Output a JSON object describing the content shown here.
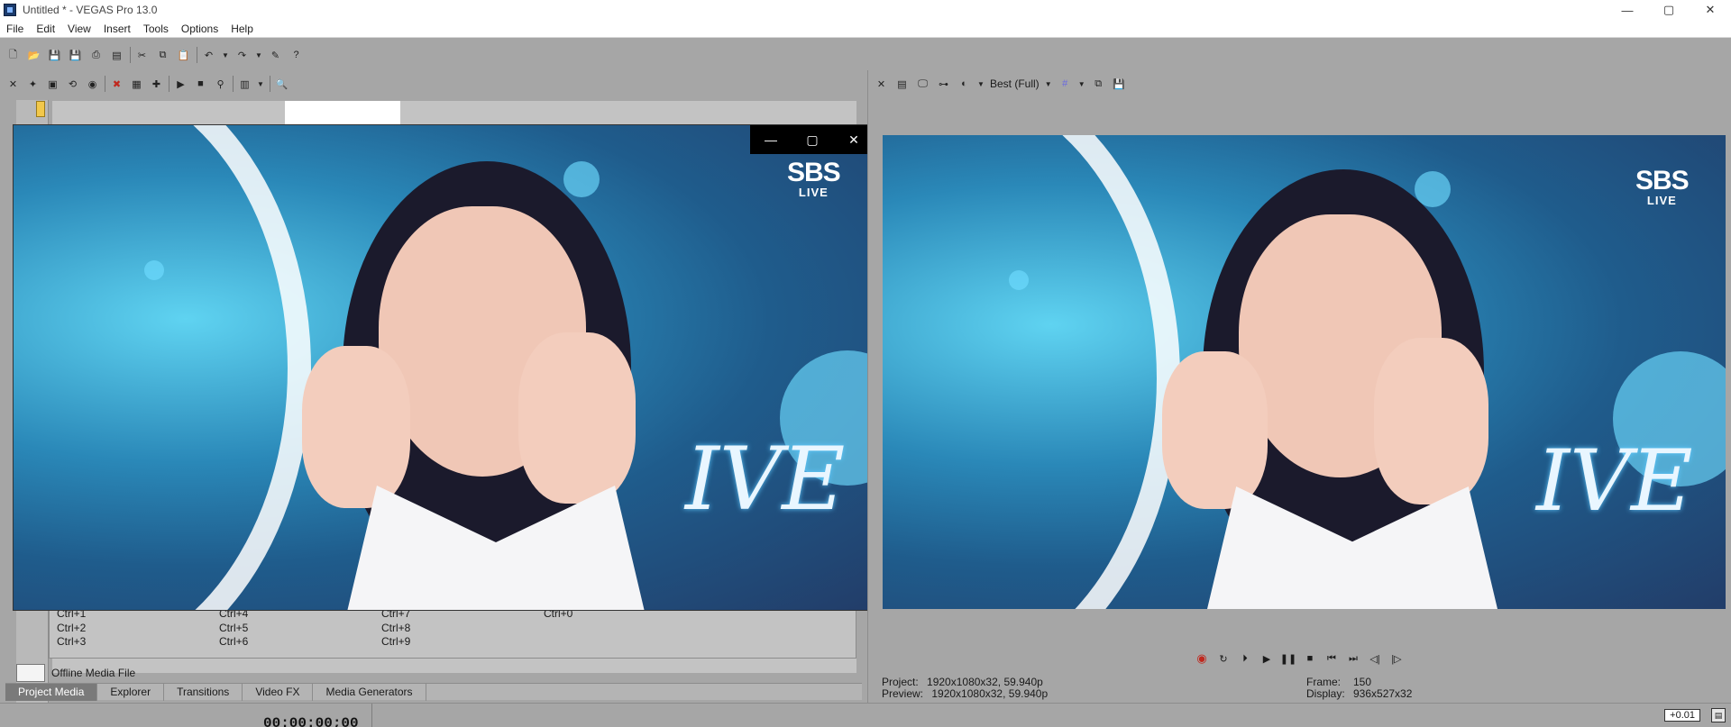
{
  "window": {
    "title": "Untitled * - VEGAS Pro 13.0",
    "minimize": "—",
    "maximize": "▢",
    "close": "✕"
  },
  "menu": [
    "File",
    "Edit",
    "View",
    "Insert",
    "Tools",
    "Options",
    "Help"
  ],
  "main_toolbar_icons": [
    "new-icon",
    "open-icon",
    "save-icon",
    "save-as-icon",
    "render-icon",
    "properties-icon",
    "cut-icon",
    "copy-icon",
    "paste-icon",
    "undo-icon",
    "redo-icon",
    "edit-tool-icon",
    "help-icon"
  ],
  "media_tools_icons": [
    "import-media-icon",
    "capture-video-icon",
    "get-media-icon",
    "web-icon",
    "remove-icon",
    "media-fx-icon",
    "add-icon",
    "play-icon",
    "stop-icon",
    "view-icon",
    "zoom-icon"
  ],
  "shortcuts": {
    "col1": [
      "Ctrl+1",
      "Ctrl+2",
      "Ctrl+3"
    ],
    "col2": [
      "Ctrl+4",
      "Ctrl+5",
      "Ctrl+6"
    ],
    "col3": [
      "Ctrl+7",
      "Ctrl+8",
      "Ctrl+9"
    ],
    "col4": [
      "Ctrl+0"
    ]
  },
  "offline_media": "Offline Media File",
  "tabs": [
    "Project Media",
    "Explorer",
    "Transitions",
    "Video FX",
    "Media Generators"
  ],
  "active_tab": "Project Media",
  "video_window": {
    "minimize": "—",
    "maximize": "▢",
    "close": "✕"
  },
  "broadcast_logo": {
    "line1": "SBS",
    "line2": "LIVE"
  },
  "stage_logo": "IVE",
  "preview": {
    "quality": "Best (Full)",
    "project_label": "Project:",
    "project_value": "1920x1080x32, 59.940p",
    "preview_label": "Preview:",
    "preview_value": "1920x1080x32, 59.940p",
    "frame_label": "Frame:",
    "frame_value": "150",
    "display_label": "Display:",
    "display_value": "936x527x32"
  },
  "transport_icons": [
    "record-icon",
    "loop-icon",
    "play-from-start-icon",
    "play-icon",
    "pause-icon",
    "stop-icon",
    "go-to-start-icon",
    "go-to-end-icon",
    "previous-frame-icon",
    "next-frame-icon"
  ],
  "timeline": {
    "timecode": "00:00:00;00",
    "rate": "+0.01"
  }
}
